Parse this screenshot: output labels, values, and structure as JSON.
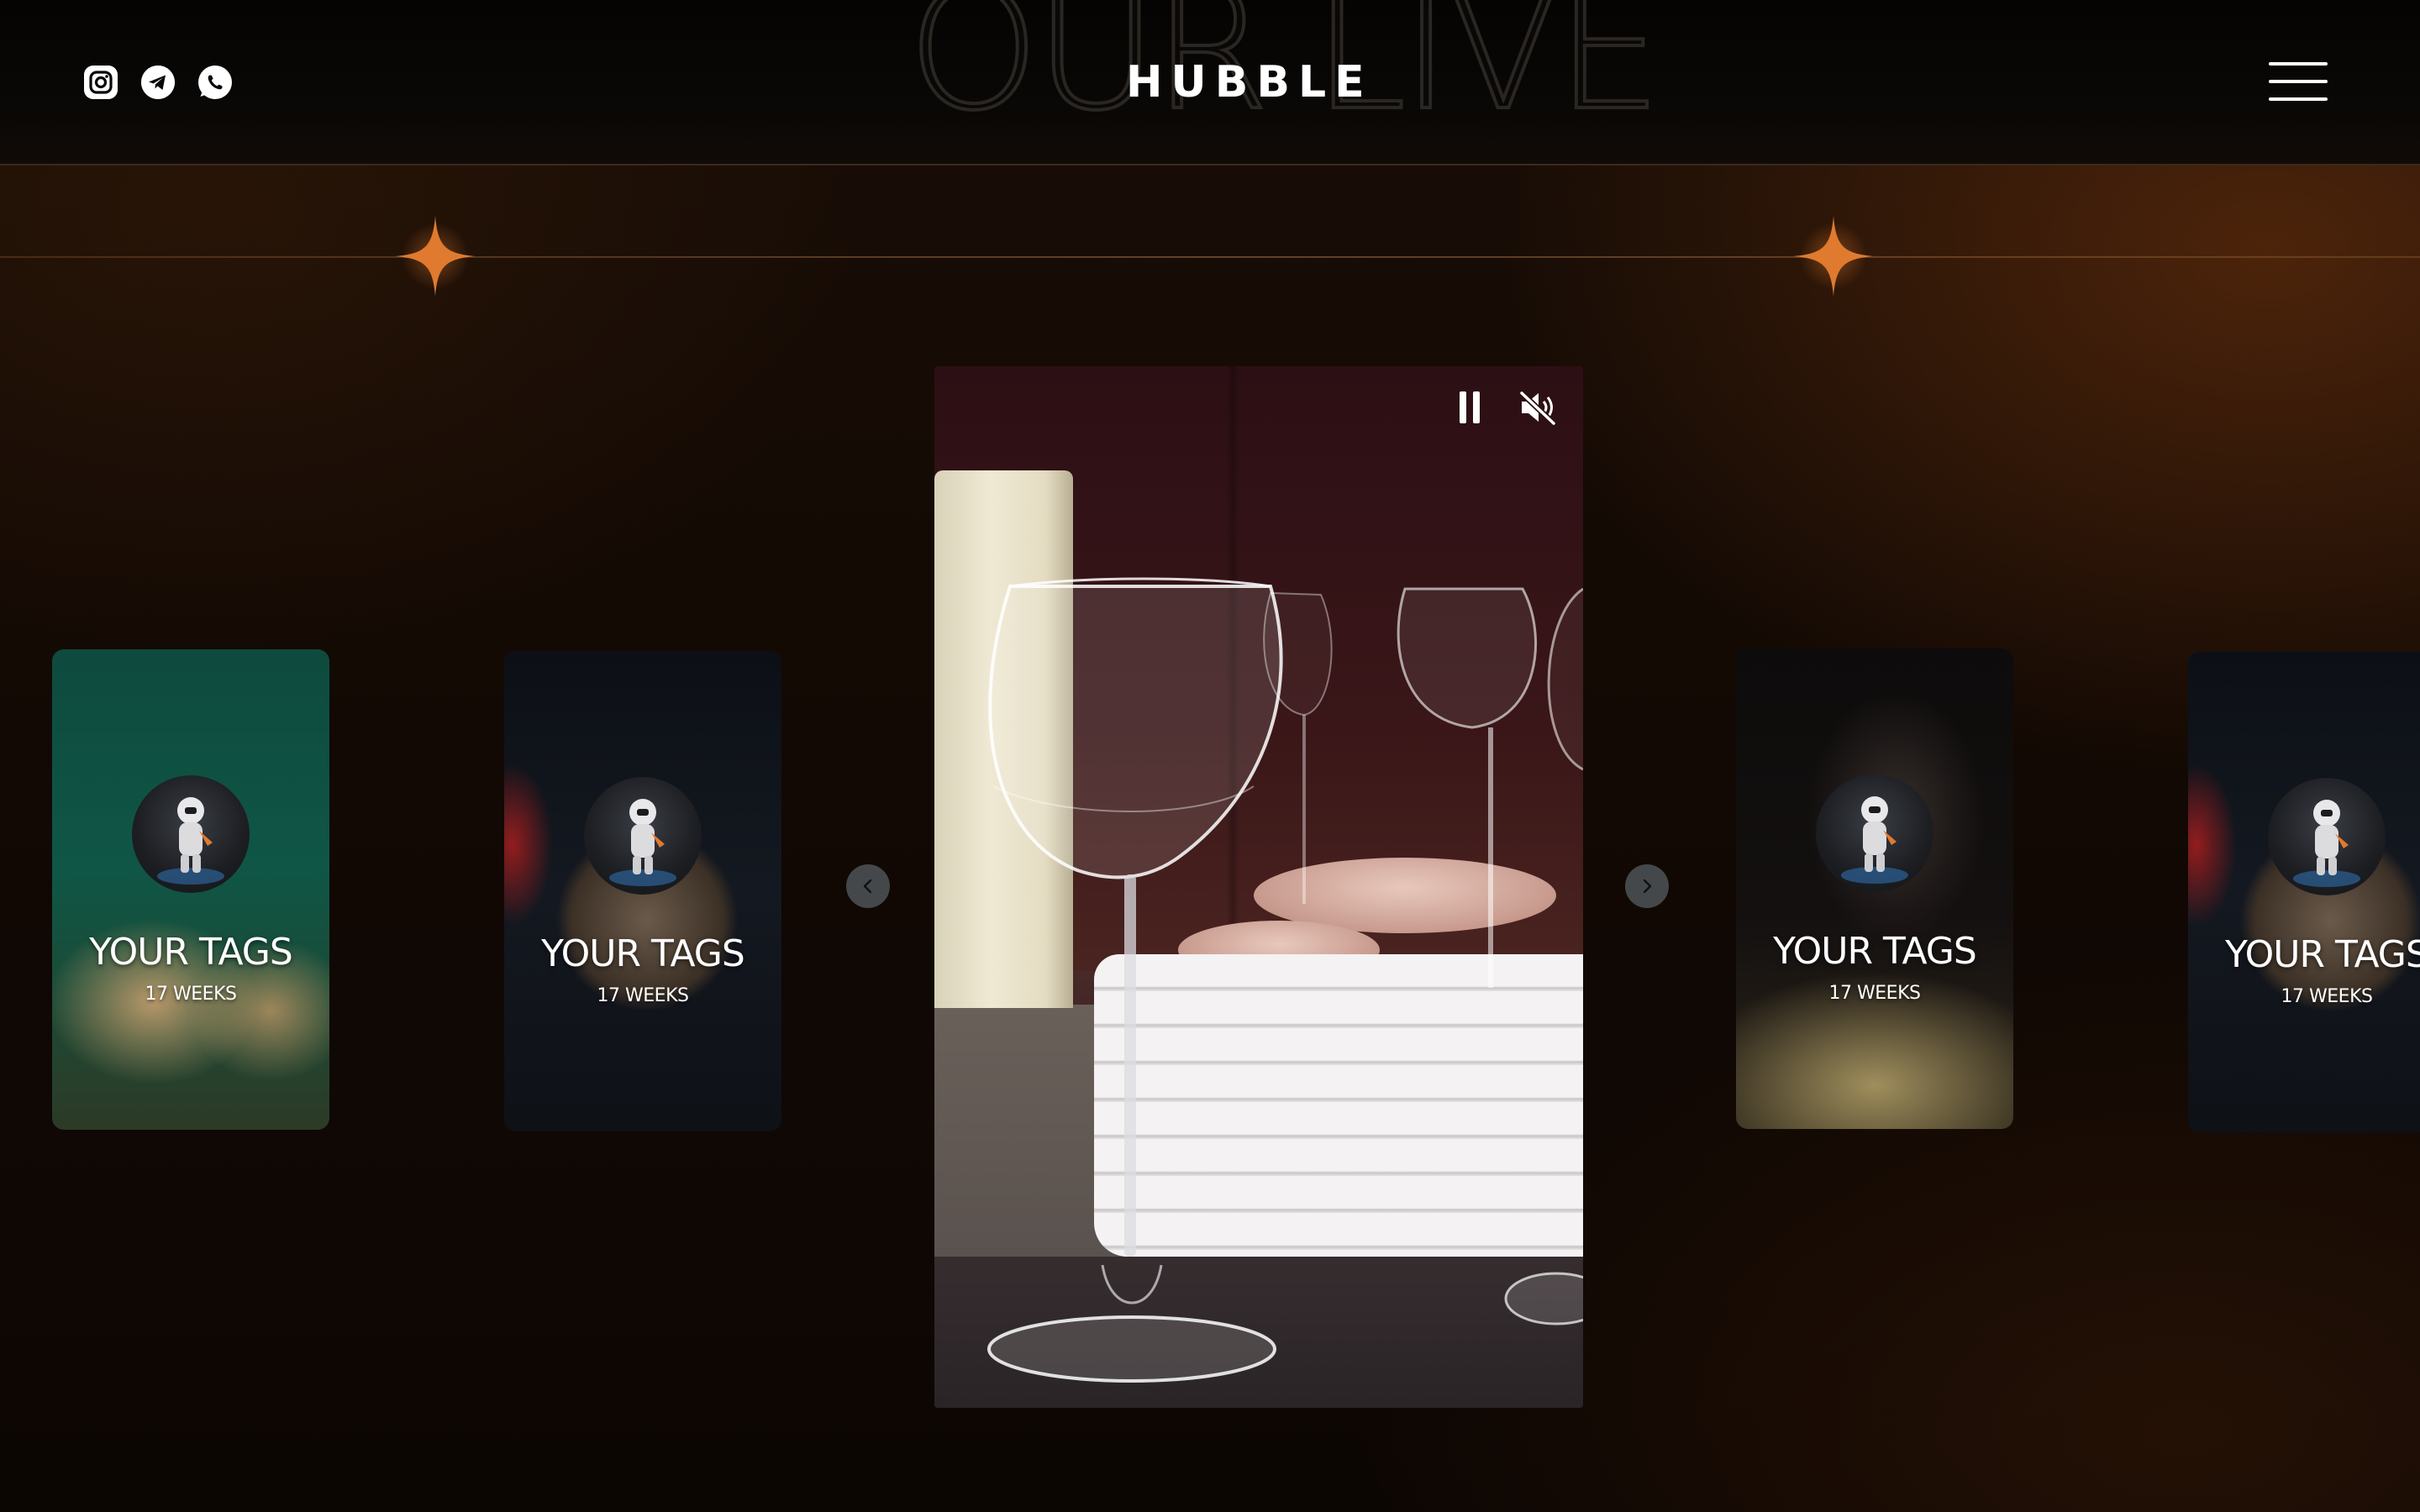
{
  "header": {
    "brand": "HUBBLE",
    "background_word": "OUR LIVE",
    "socials": [
      {
        "name": "instagram-icon"
      },
      {
        "name": "telegram-icon"
      },
      {
        "name": "whatsapp-icon"
      }
    ],
    "menu_icon": "hamburger-menu-icon"
  },
  "colors": {
    "accent_star": "#e07a2e",
    "text": "#ffffff",
    "arrow_bg": "#45484a"
  },
  "video": {
    "controls": [
      {
        "name": "pause-icon"
      },
      {
        "name": "mute-icon"
      }
    ]
  },
  "cards": [
    {
      "title": "YOUR TAGS",
      "subtitle": "17 WEEKS",
      "theme": "green"
    },
    {
      "title": "YOUR TAGS",
      "subtitle": "17 WEEKS",
      "theme": "dark-plate"
    },
    {
      "title": "YOUR TAGS",
      "subtitle": "17 WEEKS",
      "theme": "dark-noodles"
    },
    {
      "title": "YOUR TAGS",
      "subtitle": "17 WEEKS",
      "theme": "dark-plate"
    }
  ],
  "carousel": {
    "prev_icon": "chevron-left-icon",
    "next_icon": "chevron-right-icon"
  }
}
